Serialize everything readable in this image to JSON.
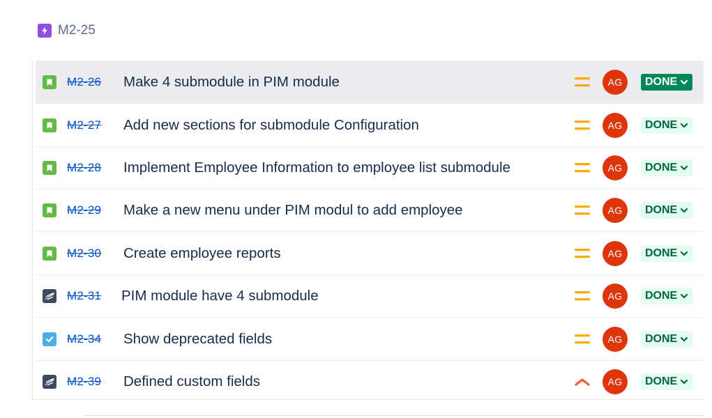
{
  "parent": {
    "icon": "epic-lightning-icon",
    "key": "M2-25"
  },
  "colors": {
    "link": "#0052cc",
    "text": "#172b4d",
    "story": "#65ba43",
    "task": "#4bade8",
    "priority_medium": "#ffab00",
    "priority_high": "#ff5630",
    "avatar": "#de350b",
    "done_bg": "#e3fcef",
    "done_text": "#006644",
    "done_active_bg": "#00875a"
  },
  "issues": [
    {
      "key": "M2-26",
      "type": "story",
      "summary": "Make 4 submodule in PIM module",
      "priority": "medium",
      "assignee": "AG",
      "status": "DONE"
    },
    {
      "key": "M2-27",
      "type": "story",
      "summary": "Add new sections for submodule Configuration",
      "priority": "medium",
      "assignee": "AG",
      "status": "DONE"
    },
    {
      "key": "M2-28",
      "type": "story",
      "summary": "Implement Employee Information to employee list submodule",
      "priority": "medium",
      "assignee": "AG",
      "status": "DONE"
    },
    {
      "key": "M2-29",
      "type": "story",
      "summary": "Make a new menu under PIM modul to add employee",
      "priority": "medium",
      "assignee": "AG",
      "status": "DONE"
    },
    {
      "key": "M2-30",
      "type": "story",
      "summary": "Create employee reports",
      "priority": "medium",
      "assignee": "AG",
      "status": "DONE"
    },
    {
      "key": "M2-31",
      "type": "custom",
      "summary": "PIM module have 4 submodule",
      "priority": "medium",
      "assignee": "AG",
      "status": "DONE"
    },
    {
      "key": "M2-34",
      "type": "task",
      "summary": "Show deprecated fields",
      "priority": "medium",
      "assignee": "AG",
      "status": "DONE"
    },
    {
      "key": "M2-39",
      "type": "custom",
      "summary": "Defined custom fields",
      "priority": "high",
      "assignee": "AG",
      "status": "DONE"
    }
  ]
}
